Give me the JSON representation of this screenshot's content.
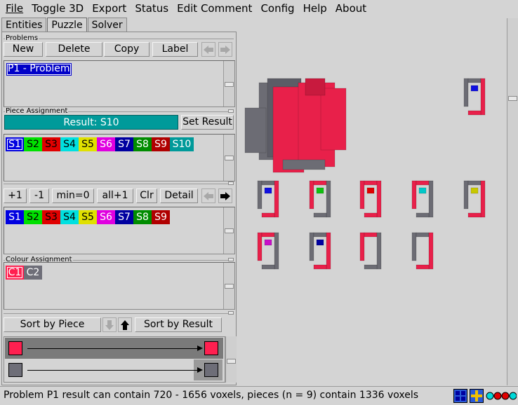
{
  "menu": [
    "File",
    "Toggle 3D",
    "Export",
    "Status",
    "Edit Comment",
    "Config",
    "Help",
    "About"
  ],
  "tabs": [
    "Entities",
    "Puzzle",
    "Solver"
  ],
  "problems": {
    "group_label": "Problems",
    "buttons": [
      "New",
      "Delete",
      "Copy",
      "Label"
    ],
    "items": [
      "P1 - Problem"
    ]
  },
  "piece_assignment": {
    "group_label": "Piece Assignment",
    "result_label": "Result: S10",
    "set_result_label": "Set Result",
    "shapes": [
      {
        "label": "S1",
        "color": "#0000e0",
        "text": "#ffffff"
      },
      {
        "label": "S2",
        "color": "#00e000",
        "text": "#000000"
      },
      {
        "label": "S3",
        "color": "#e00000",
        "text": "#000000"
      },
      {
        "label": "S4",
        "color": "#00e0e0",
        "text": "#000000"
      },
      {
        "label": "S5",
        "color": "#e0e000",
        "text": "#000000"
      },
      {
        "label": "S6",
        "color": "#e000e0",
        "text": "#ffffff"
      },
      {
        "label": "S7",
        "color": "#0000a0",
        "text": "#ffffff"
      },
      {
        "label": "S8",
        "color": "#008c00",
        "text": "#ffffff"
      },
      {
        "label": "S9",
        "color": "#b00000",
        "text": "#ffffff"
      },
      {
        "label": "S10",
        "color": "#009a9a",
        "text": "#ffffff"
      }
    ],
    "count_buttons": [
      "+1",
      "-1",
      "min=0",
      "all+1",
      "Clr",
      "Detail"
    ],
    "assigned": [
      {
        "label": "S1",
        "color": "#0000e0",
        "text": "#ffffff"
      },
      {
        "label": "S2",
        "color": "#00e000",
        "text": "#000000"
      },
      {
        "label": "S3",
        "color": "#e00000",
        "text": "#000000"
      },
      {
        "label": "S4",
        "color": "#00e0e0",
        "text": "#000000"
      },
      {
        "label": "S5",
        "color": "#e0e000",
        "text": "#000000"
      },
      {
        "label": "S6",
        "color": "#e000e0",
        "text": "#ffffff"
      },
      {
        "label": "S7",
        "color": "#0000a0",
        "text": "#ffffff"
      },
      {
        "label": "S8",
        "color": "#008c00",
        "text": "#ffffff"
      },
      {
        "label": "S9",
        "color": "#b00000",
        "text": "#ffffff"
      }
    ]
  },
  "colour_assignment": {
    "group_label": "Colour Assignment",
    "colours": [
      {
        "label": "C1",
        "color": "#ff2050",
        "text": "#ffffff"
      },
      {
        "label": "C2",
        "color": "#6e6e78",
        "text": "#ffffff"
      }
    ],
    "sort_by_piece_label": "Sort by Piece",
    "sort_by_result_label": "Sort by Result",
    "preview_colors": [
      "#ff2050",
      "#6e6e78"
    ]
  },
  "status": {
    "text": "Problem P1 result can contain 720 - 1656 voxels, pieces (n = 9) contain 1336 voxels"
  },
  "colors": {
    "voxel_red": "#e8204a",
    "voxel_grey": "#6c6c74",
    "accent_teal": "#009a9a"
  }
}
